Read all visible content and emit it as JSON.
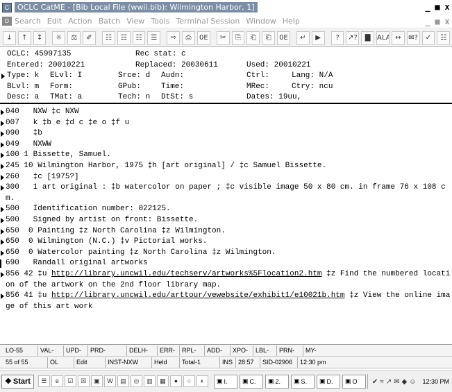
{
  "window": {
    "title": "OCLC CatME - [Bib Local File (wwii.bib): Wilmington Harbor, 1]",
    "controls": [
      "_",
      "■",
      "x"
    ]
  },
  "menu": {
    "items": [
      "Search",
      "Edit",
      "Action",
      "Batch",
      "View",
      "Tools",
      "Terminal Session",
      "Window",
      "Help"
    ]
  },
  "toolbar": {
    "buttons": [
      "↓",
      "↑",
      "↕",
      "☼",
      "⚖",
      "✐",
      "☷",
      "☷",
      "☷",
      "☰",
      "⇨",
      "⎙",
      "0E",
      "✂",
      "⎘",
      "⎗",
      "⎗",
      "0E",
      "↵",
      "▶",
      "?",
      "↗?",
      "▇",
      "ALA",
      "↔",
      "✉?",
      "✓",
      "☷"
    ]
  },
  "fixed_field": {
    "rows": [
      [
        {
          "label": "OCLC:",
          "value": "45997135"
        },
        {
          "label": "Rec stat:",
          "value": "c"
        }
      ],
      [
        {
          "label": "Entered:",
          "value": "20010221"
        },
        {
          "label": "Replaced:",
          "value": "20030611"
        },
        {
          "label": "Used:",
          "value": "20010221"
        }
      ],
      [
        {
          "label": "Type:",
          "value": "k"
        },
        {
          "label": "ELvl:",
          "value": "I"
        },
        {
          "label": "Srce:",
          "value": "d"
        },
        {
          "label": "Audn:",
          "value": ""
        },
        {
          "label": "Ctrl:",
          "value": ""
        },
        {
          "label": "Lang:",
          "value": "N/A"
        }
      ],
      [
        {
          "label": "BLvl:",
          "value": "m"
        },
        {
          "label": "Form:",
          "value": ""
        },
        {
          "label": "GPub:",
          "value": ""
        },
        {
          "label": "Time:",
          "value": ""
        },
        {
          "label": "MRec:",
          "value": ""
        },
        {
          "label": "Ctry:",
          "value": "ncu"
        }
      ],
      [
        {
          "label": "Desc:",
          "value": "a"
        },
        {
          "label": "TMat:",
          "value": "a"
        },
        {
          "label": "Tech:",
          "value": "n"
        },
        {
          "label": "DtSt:",
          "value": "s"
        },
        {
          "label": "Dates:",
          "value": "19uu,"
        }
      ]
    ]
  },
  "fields": [
    {
      "tag": "040",
      "ind": "   ",
      "text": "NXW ‡c NXW"
    },
    {
      "tag": "007",
      "ind": "   ",
      "text": "k ‡b e ‡d c ‡e o ‡f u"
    },
    {
      "tag": "090",
      "ind": "   ",
      "text": "‡b"
    },
    {
      "tag": "049",
      "ind": "   ",
      "text": "NXWW"
    },
    {
      "tag": "100",
      "ind": " 1 ",
      "text": "Bissette, Samuel."
    },
    {
      "tag": "245",
      "ind": " 10 ",
      "text": "Wilmington Harbor, 1975 ‡h [art original] / ‡c Samuel Bissette."
    },
    {
      "tag": "260",
      "ind": "   ",
      "text": "‡c [1975?]"
    },
    {
      "tag": "300",
      "ind": "   ",
      "text": "1 art original : ‡b watercolor on paper ; ‡c visible image 50 x 80 cm. in frame 76 x 108 cm."
    },
    {
      "tag": "500",
      "ind": "   ",
      "text": "Identification number: 022125."
    },
    {
      "tag": "500",
      "ind": "   ",
      "text": "Signed by artist on front: Bissette."
    },
    {
      "tag": "650",
      "ind": "  0 ",
      "text": "Painting ‡z North Carolina ‡z Wilmington."
    },
    {
      "tag": "650",
      "ind": "  0 ",
      "text": "Wilmington (N.C.) ‡v Pictorial works."
    },
    {
      "tag": "650",
      "ind": "  0 ",
      "text": "Watercolor painting ‡z North Carolina ‡z Wilmington."
    },
    {
      "tag": "690",
      "ind": "   ",
      "text": "Randall original artworks",
      "cursor": true
    },
    {
      "tag": "856",
      "ind": " 42 ",
      "pre": "‡u ",
      "link": "http://library.uncwil.edu/techserv/artworks%5Flocation2.htm",
      "post": " ‡z Find the numbered location of the artwork on the 2nd floor library map."
    },
    {
      "tag": "856",
      "ind": " 41 ",
      "pre": "‡u ",
      "link": "http://library.uncwil.edu/arttour/vewebsite/exhibit1/e10021b.htm",
      "post": " ‡z View the online image of this art work"
    }
  ],
  "status": {
    "row1": [
      "LO-55",
      "VAL-",
      "UPD-",
      "PRD-",
      "DELH-",
      "ERR-",
      "RPL-",
      "ADD-",
      "XPO-",
      "LBL-",
      "PRN-",
      "MY-"
    ],
    "row2": [
      "55 of 55",
      "OL",
      "Edit",
      "INST-NXW",
      "Held",
      "Total-1",
      "INS",
      "28:57",
      "SID-02906",
      "12:30 pm"
    ]
  },
  "taskbar": {
    "start_label": "Start",
    "quick_launch": [
      "☰",
      "e",
      "☑",
      "☒",
      "▣",
      "W",
      "▤",
      "◎",
      "▥",
      "▦",
      "●",
      "○",
      "◐"
    ],
    "tasks": [
      "I.",
      "C.",
      "2.",
      "S.",
      "D.",
      "O"
    ],
    "tray_icons": [
      "✔",
      "≈",
      "↗",
      "✉",
      "◆",
      "☺"
    ],
    "clock": "12:30 PM"
  }
}
